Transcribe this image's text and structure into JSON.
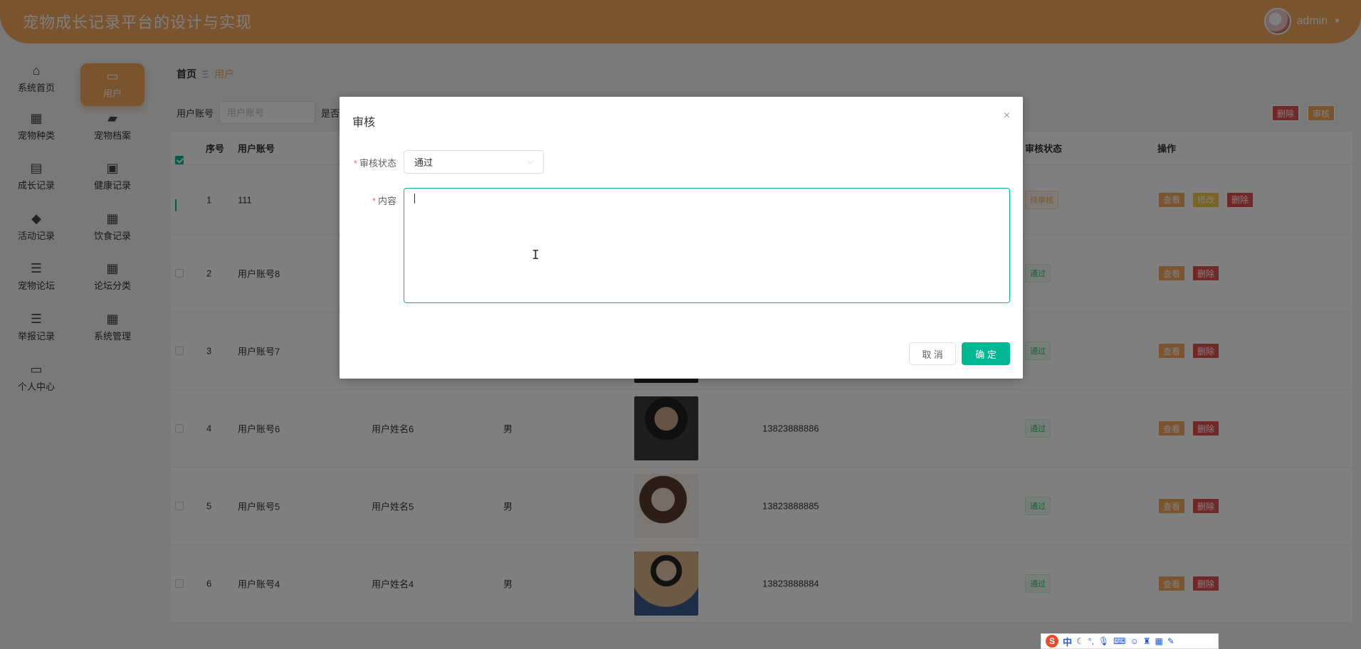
{
  "header": {
    "title": "宠物成长记录平台的设计与实现",
    "username": "admin"
  },
  "sidebar": {
    "items": [
      {
        "label": "系统首页",
        "icon": "home-icon",
        "glyph": "⌂"
      },
      {
        "label": "用户",
        "icon": "monitor-icon",
        "glyph": "▭"
      },
      {
        "label": "宠物种类",
        "icon": "grid-icon",
        "glyph": "▦"
      },
      {
        "label": "宠物档案",
        "icon": "chat-icon",
        "glyph": "▰"
      },
      {
        "label": "成长记录",
        "icon": "clipboard-icon",
        "glyph": "▤"
      },
      {
        "label": "健康记录",
        "icon": "briefcase-icon",
        "glyph": "▣"
      },
      {
        "label": "活动记录",
        "icon": "ticket-icon",
        "glyph": "◆"
      },
      {
        "label": "饮食记录",
        "icon": "apps-icon",
        "glyph": "▦"
      },
      {
        "label": "宠物论坛",
        "icon": "sliders-icon",
        "glyph": "☰"
      },
      {
        "label": "论坛分类",
        "icon": "apps-icon",
        "glyph": "▦"
      },
      {
        "label": "举报记录",
        "icon": "list-icon",
        "glyph": "☰"
      },
      {
        "label": "系统管理",
        "icon": "apps-icon",
        "glyph": "▦"
      },
      {
        "label": "个人中心",
        "icon": "wallet-icon",
        "glyph": "▭"
      }
    ]
  },
  "breadcrumb": {
    "home": "首页",
    "separator": "Ξ",
    "current": "用户"
  },
  "search": {
    "label": "用户账号",
    "placeholder": "用户账号",
    "extra_label": "是否"
  },
  "toolbar": {
    "delete_label": "删除",
    "audit_label": "审核"
  },
  "table": {
    "headers": {
      "index": "序号",
      "account": "用户账号",
      "status": "审核状态",
      "ops": "操作"
    },
    "rows": [
      {
        "index": "1",
        "account": "111",
        "name": "",
        "gender": "",
        "phone": "",
        "status": "待审核",
        "checked": true
      },
      {
        "index": "2",
        "account": "用户账号8",
        "name": "",
        "gender": "",
        "phone": "",
        "status": "通过",
        "checked": false
      },
      {
        "index": "3",
        "account": "用户账号7",
        "name": "",
        "gender": "",
        "phone": "",
        "status": "通过",
        "checked": false
      },
      {
        "index": "4",
        "account": "用户账号6",
        "name": "用户姓名6",
        "gender": "男",
        "phone": "13823888886",
        "status": "通过",
        "checked": false
      },
      {
        "index": "5",
        "account": "用户账号5",
        "name": "用户姓名5",
        "gender": "男",
        "phone": "13823888885",
        "status": "通过",
        "checked": false
      },
      {
        "index": "6",
        "account": "用户账号4",
        "name": "用户姓名4",
        "gender": "男",
        "phone": "13823888884",
        "status": "通过",
        "checked": false
      }
    ],
    "op_view": "查看",
    "op_edit": "修改",
    "op_delete": "删除"
  },
  "dialog": {
    "title": "审核",
    "close": "×",
    "status_label": "审核状态",
    "status_value": "通过",
    "content_label": "内容",
    "content_value": "",
    "cancel_label": "取 消",
    "ok_label": "确 定",
    "required_mark": "*"
  },
  "ime": {
    "brand": "S",
    "mode": "中"
  },
  "colors": {
    "accent": "#f5a95e",
    "primary": "#00b894",
    "danger": "#e35050"
  }
}
